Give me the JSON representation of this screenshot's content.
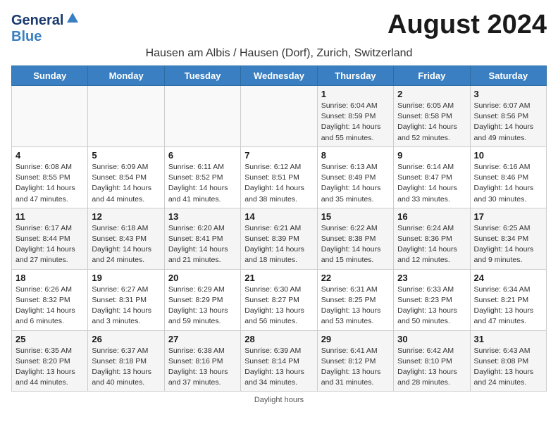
{
  "header": {
    "logo_general": "General",
    "logo_blue": "Blue",
    "month_title": "August 2024",
    "location": "Hausen am Albis / Hausen (Dorf), Zurich, Switzerland"
  },
  "weekdays": [
    "Sunday",
    "Monday",
    "Tuesday",
    "Wednesday",
    "Thursday",
    "Friday",
    "Saturday"
  ],
  "footer": {
    "note": "Daylight hours"
  },
  "weeks": [
    [
      {
        "day": "",
        "info": ""
      },
      {
        "day": "",
        "info": ""
      },
      {
        "day": "",
        "info": ""
      },
      {
        "day": "",
        "info": ""
      },
      {
        "day": "1",
        "info": "Sunrise: 6:04 AM\nSunset: 8:59 PM\nDaylight: 14 hours\nand 55 minutes."
      },
      {
        "day": "2",
        "info": "Sunrise: 6:05 AM\nSunset: 8:58 PM\nDaylight: 14 hours\nand 52 minutes."
      },
      {
        "day": "3",
        "info": "Sunrise: 6:07 AM\nSunset: 8:56 PM\nDaylight: 14 hours\nand 49 minutes."
      }
    ],
    [
      {
        "day": "4",
        "info": "Sunrise: 6:08 AM\nSunset: 8:55 PM\nDaylight: 14 hours\nand 47 minutes."
      },
      {
        "day": "5",
        "info": "Sunrise: 6:09 AM\nSunset: 8:54 PM\nDaylight: 14 hours\nand 44 minutes."
      },
      {
        "day": "6",
        "info": "Sunrise: 6:11 AM\nSunset: 8:52 PM\nDaylight: 14 hours\nand 41 minutes."
      },
      {
        "day": "7",
        "info": "Sunrise: 6:12 AM\nSunset: 8:51 PM\nDaylight: 14 hours\nand 38 minutes."
      },
      {
        "day": "8",
        "info": "Sunrise: 6:13 AM\nSunset: 8:49 PM\nDaylight: 14 hours\nand 35 minutes."
      },
      {
        "day": "9",
        "info": "Sunrise: 6:14 AM\nSunset: 8:47 PM\nDaylight: 14 hours\nand 33 minutes."
      },
      {
        "day": "10",
        "info": "Sunrise: 6:16 AM\nSunset: 8:46 PM\nDaylight: 14 hours\nand 30 minutes."
      }
    ],
    [
      {
        "day": "11",
        "info": "Sunrise: 6:17 AM\nSunset: 8:44 PM\nDaylight: 14 hours\nand 27 minutes."
      },
      {
        "day": "12",
        "info": "Sunrise: 6:18 AM\nSunset: 8:43 PM\nDaylight: 14 hours\nand 24 minutes."
      },
      {
        "day": "13",
        "info": "Sunrise: 6:20 AM\nSunset: 8:41 PM\nDaylight: 14 hours\nand 21 minutes."
      },
      {
        "day": "14",
        "info": "Sunrise: 6:21 AM\nSunset: 8:39 PM\nDaylight: 14 hours\nand 18 minutes."
      },
      {
        "day": "15",
        "info": "Sunrise: 6:22 AM\nSunset: 8:38 PM\nDaylight: 14 hours\nand 15 minutes."
      },
      {
        "day": "16",
        "info": "Sunrise: 6:24 AM\nSunset: 8:36 PM\nDaylight: 14 hours\nand 12 minutes."
      },
      {
        "day": "17",
        "info": "Sunrise: 6:25 AM\nSunset: 8:34 PM\nDaylight: 14 hours\nand 9 minutes."
      }
    ],
    [
      {
        "day": "18",
        "info": "Sunrise: 6:26 AM\nSunset: 8:32 PM\nDaylight: 14 hours\nand 6 minutes."
      },
      {
        "day": "19",
        "info": "Sunrise: 6:27 AM\nSunset: 8:31 PM\nDaylight: 14 hours\nand 3 minutes."
      },
      {
        "day": "20",
        "info": "Sunrise: 6:29 AM\nSunset: 8:29 PM\nDaylight: 13 hours\nand 59 minutes."
      },
      {
        "day": "21",
        "info": "Sunrise: 6:30 AM\nSunset: 8:27 PM\nDaylight: 13 hours\nand 56 minutes."
      },
      {
        "day": "22",
        "info": "Sunrise: 6:31 AM\nSunset: 8:25 PM\nDaylight: 13 hours\nand 53 minutes."
      },
      {
        "day": "23",
        "info": "Sunrise: 6:33 AM\nSunset: 8:23 PM\nDaylight: 13 hours\nand 50 minutes."
      },
      {
        "day": "24",
        "info": "Sunrise: 6:34 AM\nSunset: 8:21 PM\nDaylight: 13 hours\nand 47 minutes."
      }
    ],
    [
      {
        "day": "25",
        "info": "Sunrise: 6:35 AM\nSunset: 8:20 PM\nDaylight: 13 hours\nand 44 minutes."
      },
      {
        "day": "26",
        "info": "Sunrise: 6:37 AM\nSunset: 8:18 PM\nDaylight: 13 hours\nand 40 minutes."
      },
      {
        "day": "27",
        "info": "Sunrise: 6:38 AM\nSunset: 8:16 PM\nDaylight: 13 hours\nand 37 minutes."
      },
      {
        "day": "28",
        "info": "Sunrise: 6:39 AM\nSunset: 8:14 PM\nDaylight: 13 hours\nand 34 minutes."
      },
      {
        "day": "29",
        "info": "Sunrise: 6:41 AM\nSunset: 8:12 PM\nDaylight: 13 hours\nand 31 minutes."
      },
      {
        "day": "30",
        "info": "Sunrise: 6:42 AM\nSunset: 8:10 PM\nDaylight: 13 hours\nand 28 minutes."
      },
      {
        "day": "31",
        "info": "Sunrise: 6:43 AM\nSunset: 8:08 PM\nDaylight: 13 hours\nand 24 minutes."
      }
    ]
  ]
}
